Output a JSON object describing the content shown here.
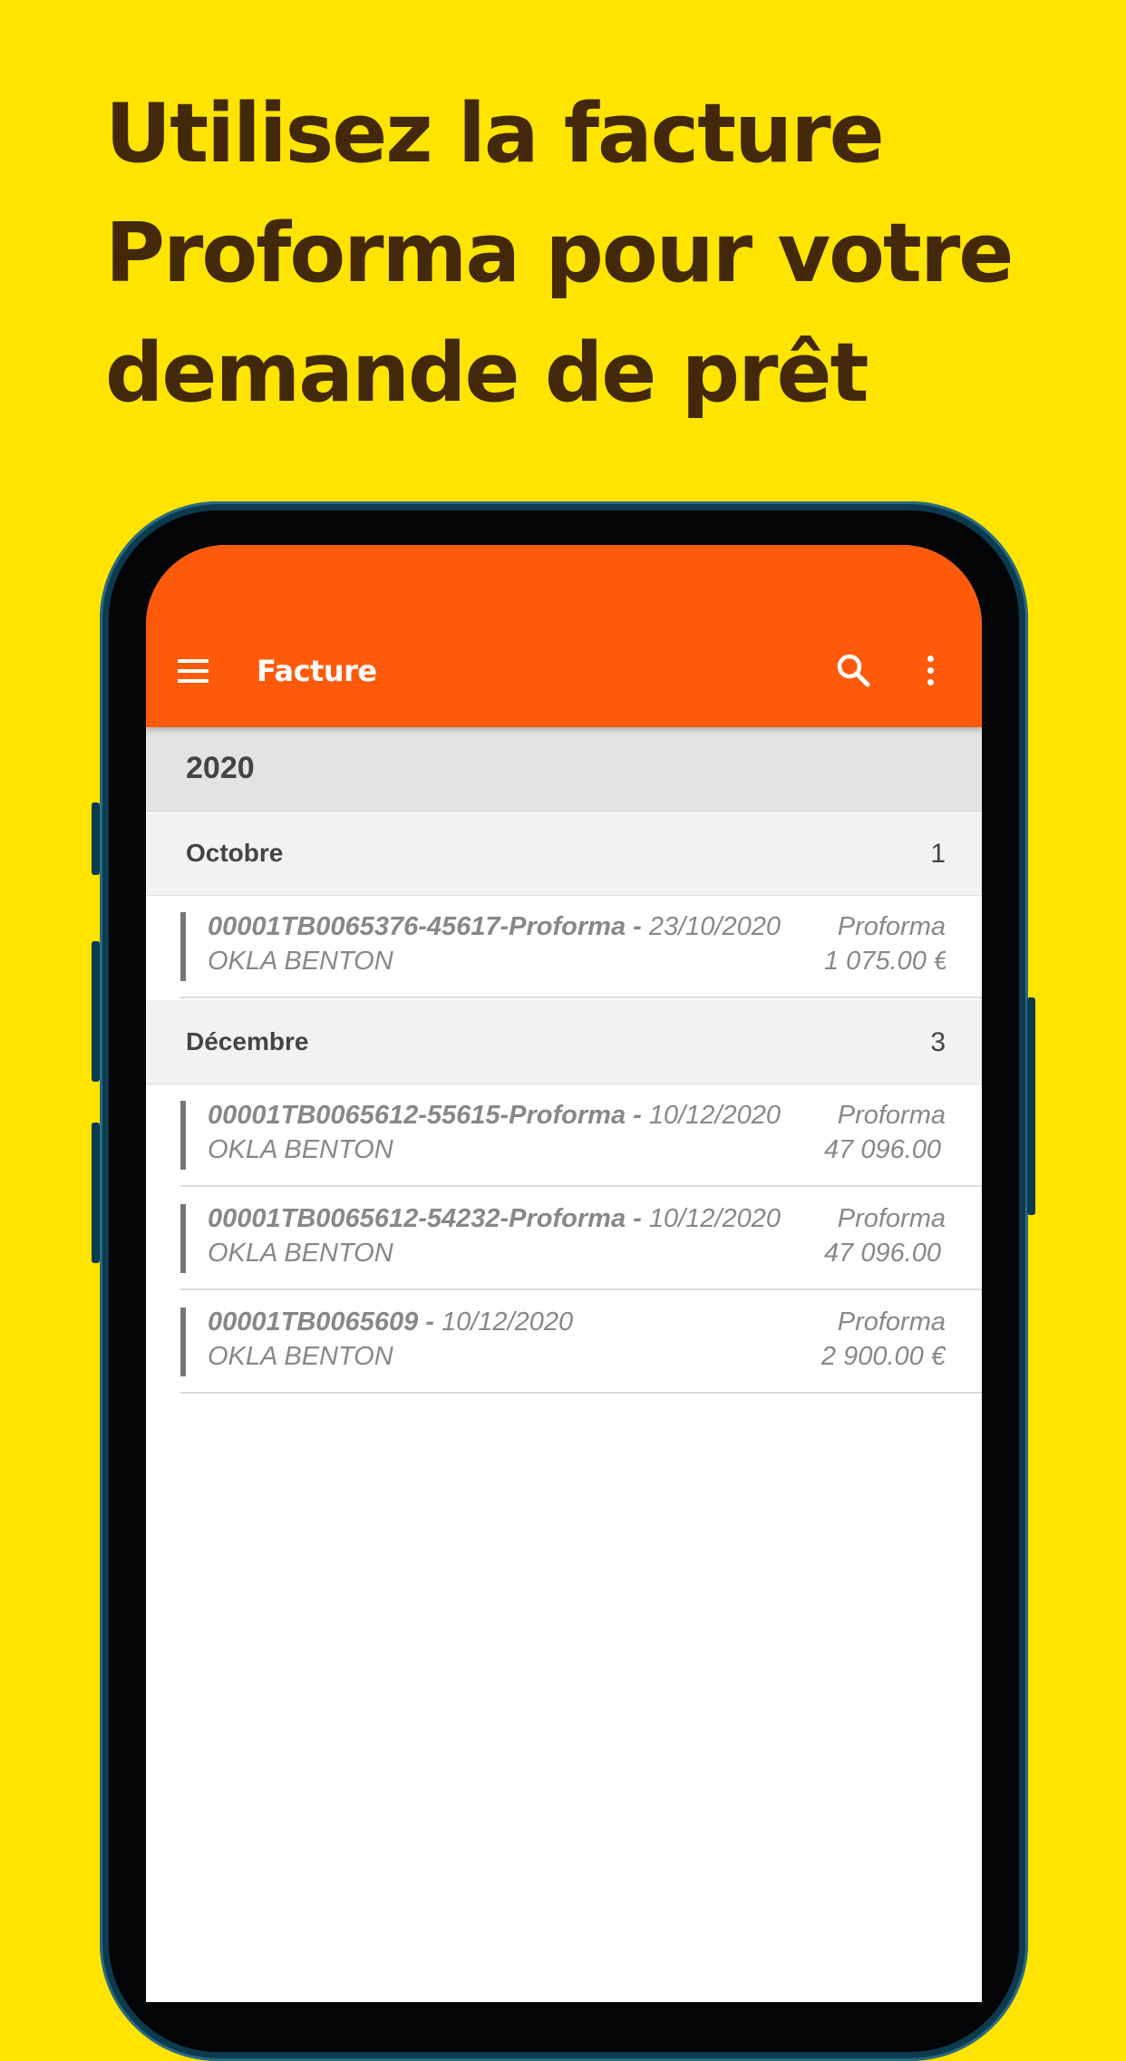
{
  "promo": {
    "headline_lines": [
      "Utilisez la facture",
      "Proforma pour votre",
      "demande de prêt"
    ]
  },
  "app": {
    "title": "Facture",
    "colors": {
      "appbar": "#FF5A0A",
      "page_background": "#FFE400",
      "headline": "#43290A"
    },
    "icons": [
      "menu-icon",
      "search-icon",
      "more-vertical-icon"
    ]
  },
  "list": {
    "year": "2020",
    "groups": [
      {
        "month": "Octobre",
        "count": "1",
        "items": [
          {
            "ref": "00001TB0065376-45617-Proforma",
            "sep": " - ",
            "date": "23/10/2020",
            "client": "OKLA BENTON",
            "type": "Proforma",
            "amount": "1 075.00 €"
          }
        ]
      },
      {
        "month": "Décembre",
        "count": "3",
        "items": [
          {
            "ref": "00001TB0065612-55615-Proforma",
            "sep": " - ",
            "date": "10/12/2020",
            "client": "OKLA BENTON",
            "type": "Proforma",
            "amount": "47 096.00 €"
          },
          {
            "ref": "00001TB0065612-54232-Proforma",
            "sep": " - ",
            "date": "10/12/2020",
            "client": "OKLA BENTON",
            "type": "Proforma",
            "amount": "47 096.00 €"
          },
          {
            "ref": "00001TB0065609",
            "sep": " - ",
            "date": "10/12/2020",
            "client": "OKLA BENTON",
            "type": "Proforma",
            "amount": "2 900.00 €"
          }
        ]
      }
    ]
  }
}
